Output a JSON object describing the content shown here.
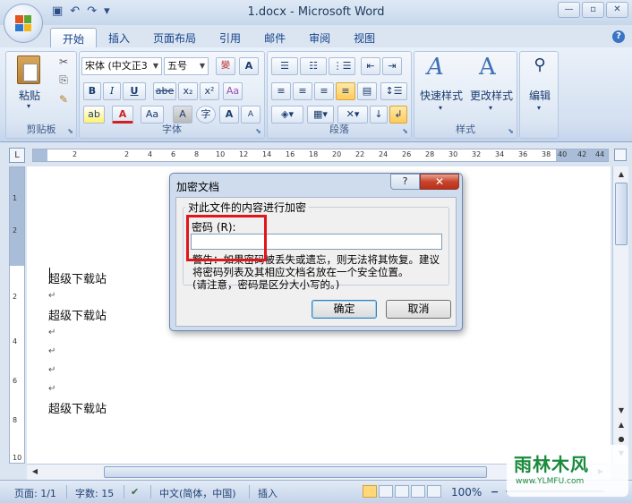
{
  "window": {
    "title": "1.docx - Microsoft Word",
    "minimize": "—",
    "restore": "▫",
    "close": "✕"
  },
  "qat": {
    "save": "▣",
    "undo": "↶",
    "redo": "↷",
    "more": "▾"
  },
  "tabs": [
    "开始",
    "插入",
    "页面布局",
    "引用",
    "邮件",
    "审阅",
    "视图"
  ],
  "ribbon": {
    "clipboard": {
      "label": "剪贴板",
      "paste": "粘贴",
      "cut": "✂",
      "copy": "⎘",
      "format_painter": "✎"
    },
    "font": {
      "label": "字体",
      "font_name": "宋体 (中文正3",
      "font_size": "五号",
      "bold": "B",
      "italic": "I",
      "underline": "U",
      "strike": "abe",
      "sub": "x₂",
      "sup": "x²",
      "clear": "Aa",
      "highlight": "ab",
      "color": "A",
      "case": "Aa",
      "shade": "A",
      "enclose": "字",
      "grow": "A",
      "shrink": "A",
      "phonetic": "變",
      "border": "A"
    },
    "paragraph": {
      "label": "段落"
    },
    "styles": {
      "label": "样式",
      "quick": "快速样式",
      "change": "更改样式"
    },
    "editing": {
      "label": "编辑"
    }
  },
  "ruler": {
    "corner": "L",
    "ticks": [
      "2",
      "2",
      "4",
      "6",
      "8",
      "10",
      "12",
      "14",
      "16",
      "18",
      "20",
      "22",
      "24",
      "26",
      "28",
      "30",
      "32",
      "34",
      "36",
      "38",
      "40",
      "42",
      "44"
    ],
    "vticks": [
      "1",
      "2",
      "2",
      "4",
      "6",
      "8",
      "10"
    ]
  },
  "document": {
    "lines": [
      "超级下载站",
      "超级下载站",
      "超级下载站"
    ],
    "para_mark": "↵"
  },
  "dialog": {
    "title": "加密文档",
    "help": "?",
    "close": "✕",
    "group_legend": "对此文件的内容进行加密",
    "password_label": "密码 (R):",
    "password_value": "",
    "warning_1": "警告：如果密码被丢失或遗忘，则无法将其恢复。建议将密码列表及其相应文档名放在一个安全位置。",
    "warning_2": "(请注意，密码是区分大小写的。)",
    "ok": "确定",
    "cancel": "取消"
  },
  "status": {
    "page": "页面: 1/1",
    "words": "字数: 15",
    "language": "中文(简体，中国)",
    "mode": "插入",
    "zoom": "100%",
    "zoom_minus": "−",
    "zoom_plus": "+"
  },
  "watermark": {
    "brand": "雨林木风",
    "url": "www.YLMFU.com"
  },
  "colors": {
    "accent": "#15428b",
    "highlight_box": "#e0161c",
    "close_red": "#c8442b"
  }
}
